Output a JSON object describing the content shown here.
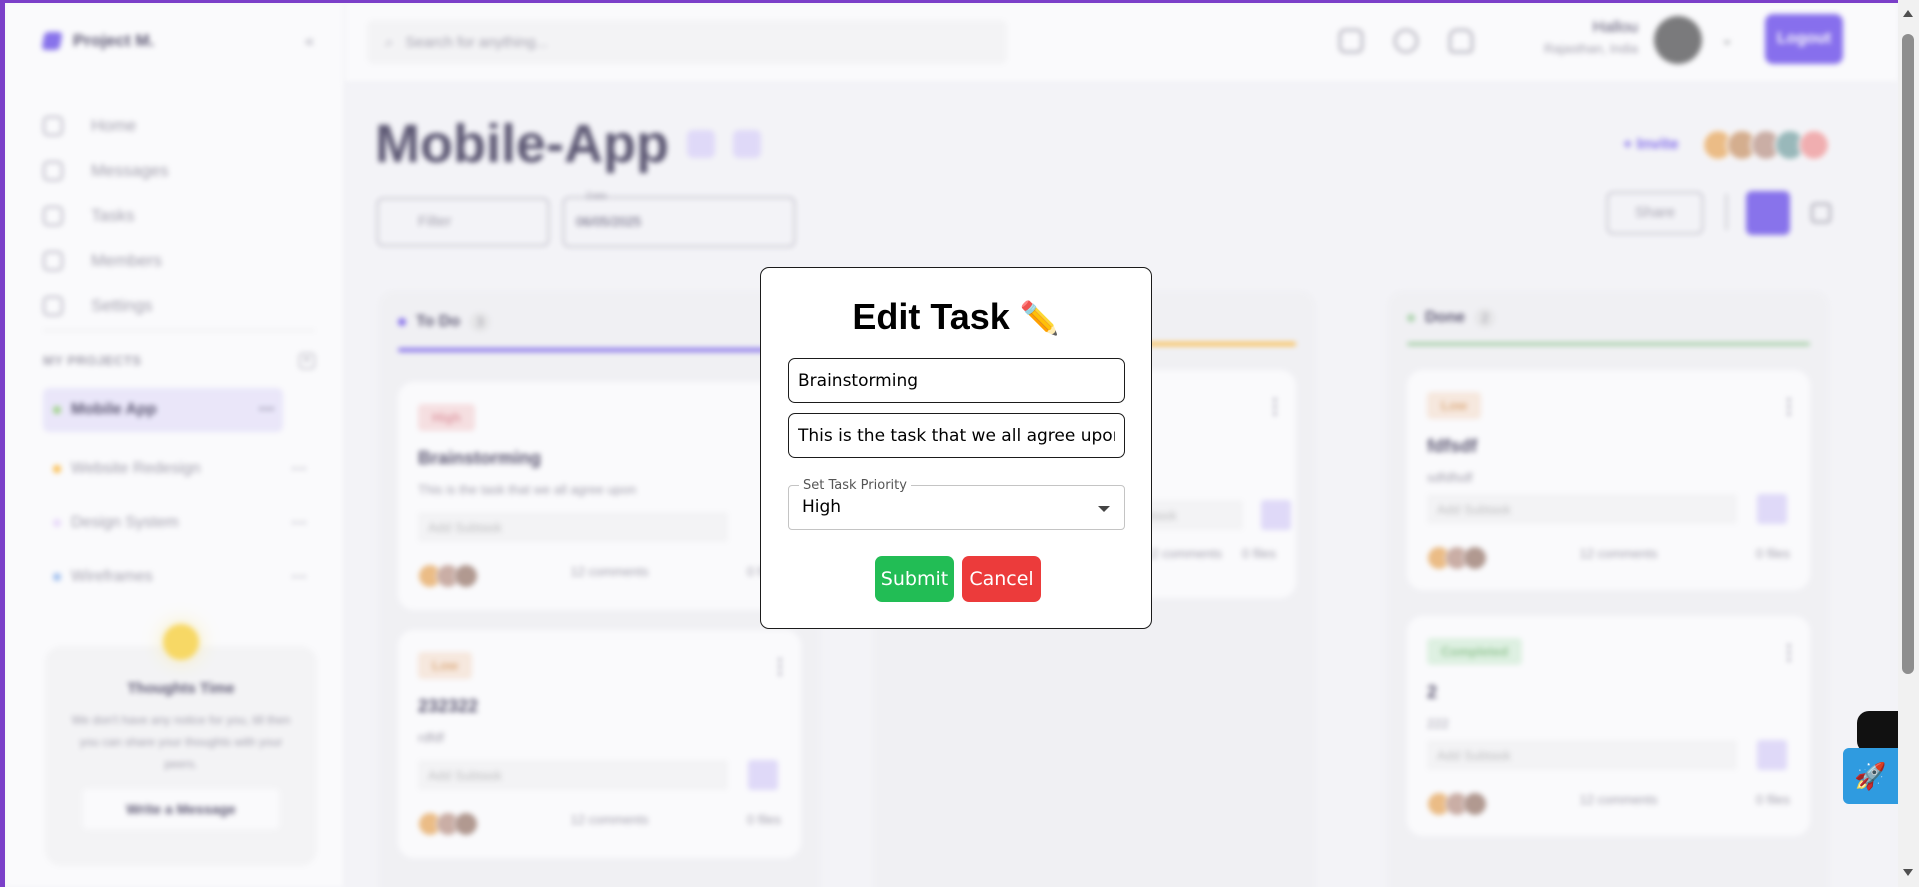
{
  "sidebar": {
    "brand": "Project M.",
    "nav": [
      {
        "label": "Home",
        "icon": "home-icon"
      },
      {
        "label": "Messages",
        "icon": "message-icon"
      },
      {
        "label": "Tasks",
        "icon": "tasks-icon"
      },
      {
        "label": "Members",
        "icon": "members-icon"
      },
      {
        "label": "Settings",
        "icon": "settings-icon"
      }
    ],
    "projects_heading": "MY PROJECTS",
    "projects": [
      {
        "label": "Mobile App",
        "color": "#7ac555"
      },
      {
        "label": "Website Redesign",
        "color": "#ffa500"
      },
      {
        "label": "Design System",
        "color": "#e4ccfd"
      },
      {
        "label": "Wireframes",
        "color": "#76a5ea"
      }
    ],
    "thoughts": {
      "title": "Thoughts Time",
      "body": "We don't have any notice for you, till then you can share your thoughts with your peers.",
      "button": "Write a Message"
    }
  },
  "header": {
    "search_placeholder": "Search for anything...",
    "user_name": "Hallou",
    "user_location": "Rajasthan, India",
    "logout": "Logout"
  },
  "board": {
    "title": "Mobile-App",
    "invite": "Invite",
    "filter": "Filter",
    "date_caption": "Date",
    "date_value": "06/05/2025",
    "share": "Share",
    "columns": [
      {
        "name": "To Do",
        "count": "3",
        "color": "#5030e5"
      },
      {
        "name": "Done",
        "count": "2",
        "color": "#8bc48a"
      }
    ],
    "cards": [
      {
        "tag": "High",
        "title": "Brainstorming",
        "desc": "This is the task that we all agree upon",
        "subtask": "Add Subtask",
        "comments": "12 comments",
        "files": "0 files"
      },
      {
        "tag": "Low",
        "title": "232322",
        "desc": "rdfdf",
        "subtask": "Add Subtask",
        "comments": "12 comments",
        "files": "0 files"
      },
      {
        "tag": "Low",
        "title": "fdfsdf",
        "desc": "sdfdfsdf",
        "subtask": "Add Subtask",
        "comments": "12 comments",
        "files": "0 files"
      },
      {
        "tag": "Completed",
        "title": "2",
        "desc": "222",
        "subtask": "Add Subtask",
        "comments": "12 comments",
        "files": "0 files"
      },
      {
        "subtask": "Add Subtask",
        "comments": "12 comments",
        "files": "0 files"
      }
    ]
  },
  "modal": {
    "title": "Edit Task",
    "title_icon": "pencil-emoji",
    "task_name": "Brainstorming",
    "task_description": "This is the task that we all agree upon",
    "priority_label": "Set Task Priority",
    "priority_value": "High",
    "submit": "Submit",
    "cancel": "Cancel"
  }
}
